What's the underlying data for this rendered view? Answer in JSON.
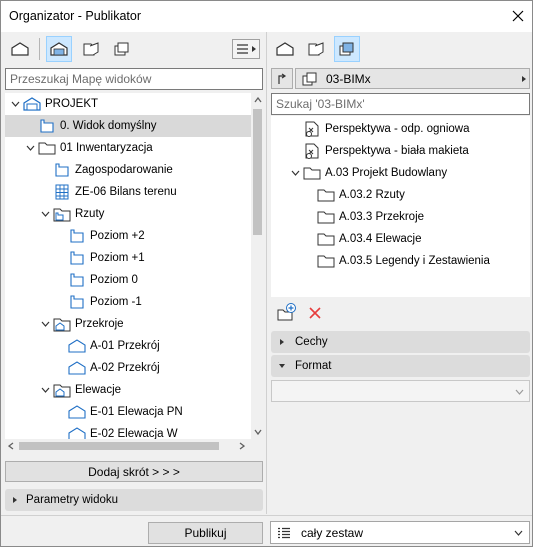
{
  "window": {
    "title": "Organizator - Publikator",
    "close_glyph": "✕"
  },
  "left": {
    "search_placeholder": "Przeszukaj Mapę widoków",
    "tree": [
      {
        "label": "PROJEKT",
        "icon": "project-icon",
        "chevron": "down",
        "level": 0
      },
      {
        "label": "0. Widok domyślny",
        "icon": "view-icon",
        "chevron": "none",
        "level": 1,
        "selected": true
      },
      {
        "label": "01 Inwentaryzacja",
        "icon": "folder-icon",
        "chevron": "down",
        "level": 1
      },
      {
        "label": "Zagospodarowanie",
        "icon": "view-icon",
        "chevron": "none",
        "level": 2
      },
      {
        "label": "ZE-06 Bilans terenu",
        "icon": "grid-icon",
        "chevron": "none",
        "level": 2
      },
      {
        "label": "Rzuty",
        "icon": "folder-plan-icon",
        "chevron": "down",
        "level": 2
      },
      {
        "label": "Poziom +2",
        "icon": "view-icon",
        "chevron": "none",
        "level": 3
      },
      {
        "label": "Poziom +1",
        "icon": "view-icon",
        "chevron": "none",
        "level": 3
      },
      {
        "label": "Poziom 0",
        "icon": "view-icon",
        "chevron": "none",
        "level": 3
      },
      {
        "label": "Poziom -1",
        "icon": "view-icon",
        "chevron": "none",
        "level": 3
      },
      {
        "label": "Przekroje",
        "icon": "folder-section-icon",
        "chevron": "down",
        "level": 2
      },
      {
        "label": "A-01 Przekrój",
        "icon": "section-icon",
        "chevron": "none",
        "level": 3
      },
      {
        "label": "A-02 Przekrój",
        "icon": "section-icon",
        "chevron": "none",
        "level": 3
      },
      {
        "label": "Elewacje",
        "icon": "folder-section-icon",
        "chevron": "down",
        "level": 2
      },
      {
        "label": "E-01 Elewacja PN",
        "icon": "section-icon",
        "chevron": "none",
        "level": 3
      },
      {
        "label": "E-02 Elewacja W",
        "icon": "section-icon",
        "chevron": "none",
        "level": 3
      }
    ],
    "add_shortcut_label": "Dodaj skrót > > >",
    "view_params_label": "Parametry widoku"
  },
  "right": {
    "set_name": "03-BIMx",
    "search_placeholder": "Szukaj '03-BIMx'",
    "tree": [
      {
        "label": "Perspektywa - odp. ogniowa",
        "icon": "perspective-icon",
        "chevron": "none",
        "level": 0
      },
      {
        "label": "Perspektywa - biała makieta",
        "icon": "perspective-icon",
        "chevron": "none",
        "level": 0
      },
      {
        "label": "A.03 Projekt Budowlany",
        "icon": "folder-icon",
        "chevron": "down",
        "level": 0
      },
      {
        "label": "A.03.2 Rzuty",
        "icon": "folder-icon",
        "chevron": "none",
        "level": 1
      },
      {
        "label": "A.03.3 Przekroje",
        "icon": "folder-icon",
        "chevron": "none",
        "level": 1
      },
      {
        "label": "A.03.4 Elewacje",
        "icon": "folder-icon",
        "chevron": "none",
        "level": 1
      },
      {
        "label": "A.03.5 Legendy i Zestawienia",
        "icon": "folder-icon",
        "chevron": "none",
        "level": 1
      }
    ],
    "cechy_label": "Cechy",
    "format_label": "Format",
    "format_value": ""
  },
  "bottom": {
    "publish_label": "Publikuj",
    "scope_value": "cały zestaw"
  },
  "colors": {
    "accent_blue": "#1f6fc5",
    "delete_red": "#e63c3c",
    "selected_row": "#d9d9d9",
    "toolbar_selected": "#cde8ff"
  }
}
